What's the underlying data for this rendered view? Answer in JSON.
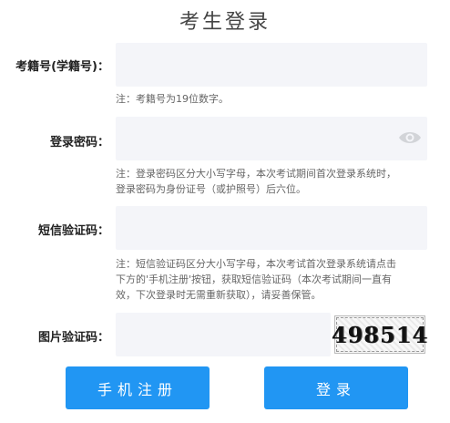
{
  "title": "考生登录",
  "exam_id": {
    "label": "考籍号(学籍号)：",
    "value": "",
    "placeholder": "",
    "note": "注：考籍号为19位数字。"
  },
  "password": {
    "label": "登录密码：",
    "value": "",
    "placeholder": "",
    "toggle_icon": "eye-icon",
    "note_line1": "注：登录密码区分大小写字母，本次考试期间首次登录系统时，",
    "note_line2": "登录密码为身份证号（或护照号）后六位。"
  },
  "sms_code": {
    "label": "短信验证码：",
    "value": "",
    "placeholder": "",
    "note_line1": "注：短信验证码区分大小写字母，本次考试首次登录系统请点击",
    "note_line2": "下方的'手机注册'按钮，获取短信验证码（本次考试期间一直有",
    "note_line3": "效，下次登录时无需重新获取），请妥善保管。"
  },
  "image_code": {
    "label": "图片验证码：",
    "value": "",
    "placeholder": "",
    "captcha_text": "498514"
  },
  "buttons": {
    "register": "手机注册",
    "login": "登录"
  },
  "colors": {
    "accent": "#2196f3",
    "field_bg": "#f4f5f9"
  }
}
